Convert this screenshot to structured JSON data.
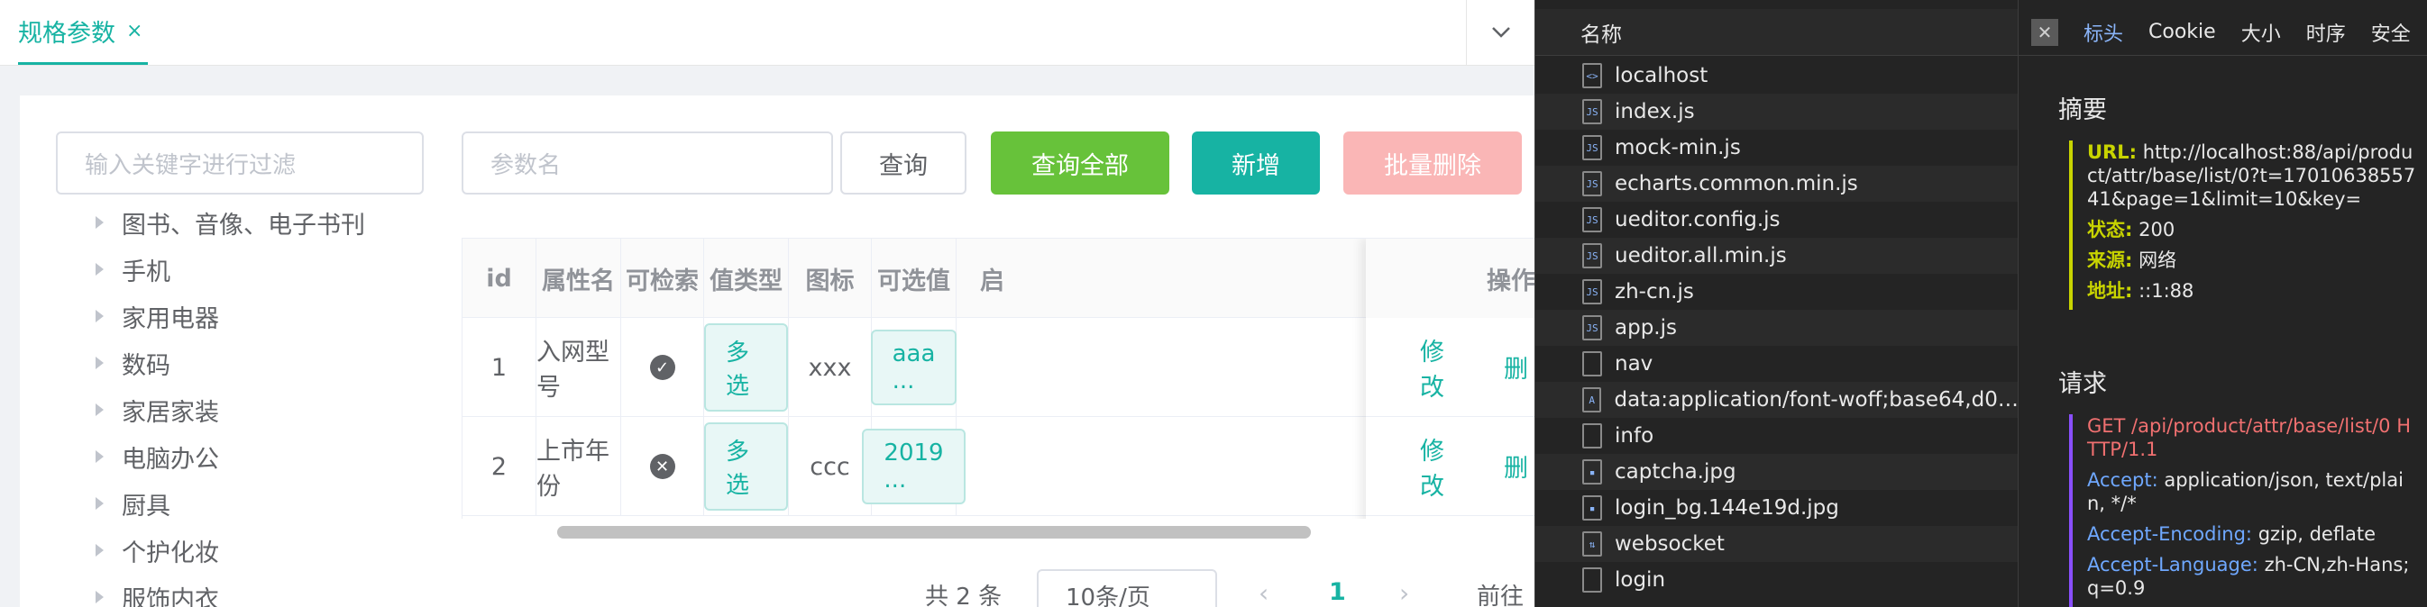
{
  "tabbar": {
    "tab_label": "规格参数",
    "tab_close": "×"
  },
  "sidebar": {
    "filter_placeholder": "输入关键字进行过滤",
    "tree": [
      "图书、音像、电子书刊",
      "手机",
      "家用电器",
      "数码",
      "家居家装",
      "电脑办公",
      "厨具",
      "个护化妆",
      "服饰内衣"
    ]
  },
  "toolbar": {
    "param_placeholder": "参数名",
    "query_label": "查询",
    "query_all_label": "查询全部",
    "add_label": "新增",
    "batch_delete_label": "批量删除"
  },
  "table": {
    "headers": [
      "id",
      "属性名",
      "可检索",
      "值类型",
      "图标",
      "可选值",
      "启",
      "操作"
    ],
    "rows": [
      {
        "id": "1",
        "name": "入网型号",
        "searchable_icon": "check-circle-icon",
        "searchable_glyph": "✓",
        "value_type": "多选",
        "icon": "xxx",
        "options": "aaa ...",
        "edit": "修改",
        "delete": "删"
      },
      {
        "id": "2",
        "name": "上市年份",
        "searchable_icon": "x-circle-icon",
        "searchable_glyph": "✕",
        "value_type": "多选",
        "icon": "ccc",
        "options": "2019 ...",
        "edit": "修改",
        "delete": "删"
      }
    ]
  },
  "pager": {
    "total": "共 2 条",
    "page_size": "10条/页",
    "current_page": "1",
    "jump_label": "前往"
  },
  "devtools": {
    "name_header": "名称",
    "requests": [
      {
        "name": "localhost",
        "type": "doc"
      },
      {
        "name": "index.js",
        "type": "js"
      },
      {
        "name": "mock-min.js",
        "type": "js"
      },
      {
        "name": "echarts.common.min.js",
        "type": "js"
      },
      {
        "name": "ueditor.config.js",
        "type": "js"
      },
      {
        "name": "ueditor.all.min.js",
        "type": "js"
      },
      {
        "name": "zh-cn.js",
        "type": "js"
      },
      {
        "name": "app.js",
        "type": "js"
      },
      {
        "name": "nav",
        "type": "xhr"
      },
      {
        "name": "data:application/font-woff;base64,d09...",
        "type": "font"
      },
      {
        "name": "info",
        "type": "xhr"
      },
      {
        "name": "captcha.jpg",
        "type": "img"
      },
      {
        "name": "login_bg.144e19d.jpg",
        "type": "img"
      },
      {
        "name": "websocket",
        "type": "ws"
      },
      {
        "name": "login",
        "type": "xhr"
      }
    ],
    "tabs": [
      "标头",
      "Cookie",
      "大小",
      "时序",
      "安全"
    ],
    "close_glyph": "✕",
    "summary_title": "摘要",
    "summary": {
      "url_key": "URL:",
      "url_val": "http://localhost:88/api/product/attr/base/list/0?t=1701063855741&page=1&limit=10&key=",
      "status_key": "状态:",
      "status_val": "200",
      "source_key": "来源:",
      "source_val": "网络",
      "address_key": "地址:",
      "address_val": "::1:88"
    },
    "request_title": "请求",
    "request": {
      "line": "GET /api/product/attr/base/list/0 HTTP/1.1",
      "accept_key": "Accept:",
      "accept_val": "application/json, text/plain, */*",
      "encoding_key": "Accept-Encoding:",
      "encoding_val": "gzip, deflate",
      "language_key": "Accept-Language:",
      "language_val": "zh-CN,zh-Hans;q=0.9"
    }
  }
}
